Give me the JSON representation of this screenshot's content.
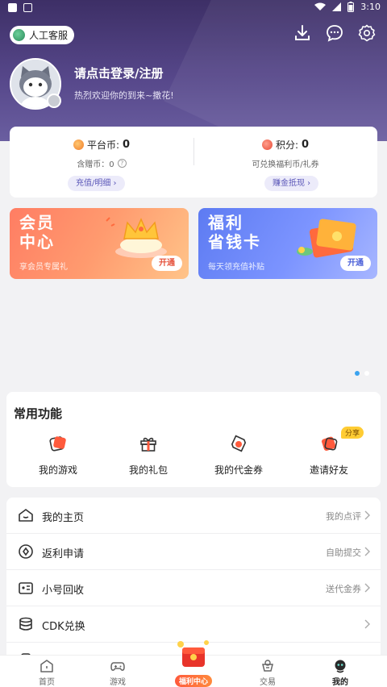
{
  "status_bar": {
    "time": "3:10"
  },
  "header": {
    "service_label": "人工客服",
    "login_prompt": "请点击登录/注册",
    "welcome": "热烈欢迎你的到来~撒花!"
  },
  "wallet": {
    "platform_label": "平台币:",
    "platform_value": "0",
    "bound_label": "含赠币：0",
    "recharge_label": "充值/明细 ›",
    "points_label": "积分:",
    "points_value": "0",
    "points_desc": "可兑换福利币/礼券",
    "earn_label": "赚金抵现 ›"
  },
  "banners": [
    {
      "title": "会员中心",
      "title_line1": "会员",
      "title_line2": "中心",
      "subtitle": "享会员专属礼",
      "button": "开通"
    },
    {
      "title": "福利省钱卡",
      "title_line1": "福利",
      "title_line2": "省钱卡",
      "subtitle": "每天领充值补贴",
      "button": "开通"
    }
  ],
  "common_functions": {
    "title": "常用功能",
    "items": [
      {
        "label": "我的游戏",
        "icon": "game-card-icon"
      },
      {
        "label": "我的礼包",
        "icon": "gift-icon"
      },
      {
        "label": "我的代金券",
        "icon": "coupon-icon"
      },
      {
        "label": "邀请好友",
        "icon": "invite-icon",
        "badge": "分享"
      }
    ]
  },
  "menu": [
    {
      "label": "我的主页",
      "right": "我的点评",
      "icon": "home-icon"
    },
    {
      "label": "返利申请",
      "right": "自助提交",
      "icon": "rebate-icon"
    },
    {
      "label": "小号回收",
      "right": "送代金券",
      "icon": "recycle-icon"
    },
    {
      "label": "CDK兑换",
      "right": "",
      "icon": "cdk-icon"
    },
    {
      "label": "",
      "right": "",
      "icon": "partial-icon"
    }
  ],
  "bottom_nav": {
    "items": [
      {
        "label": "首页",
        "icon": "home-nav-icon"
      },
      {
        "label": "游戏",
        "icon": "gamepad-icon"
      },
      {
        "label": "福利中心",
        "icon": "welfare-gift-icon"
      },
      {
        "label": "交易",
        "icon": "trade-icon"
      },
      {
        "label": "我的",
        "icon": "profile-icon",
        "active": true
      }
    ]
  },
  "colors": {
    "header": "#56478a",
    "accent": "#5b57b8",
    "vip": "#ff8a66",
    "welfare": "#6f88f8",
    "active_dot": "#3aa3ef"
  }
}
